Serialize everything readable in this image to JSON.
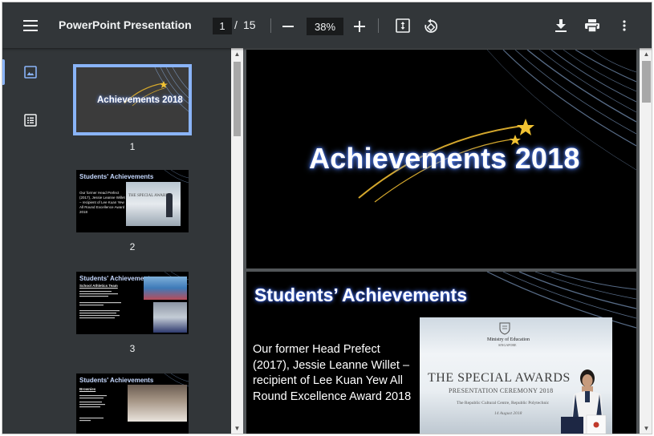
{
  "toolbar": {
    "title": "PowerPoint Presentation",
    "current_page": "1",
    "page_separator": "/",
    "total_pages": "15",
    "zoom": "38%"
  },
  "icons": {
    "menu": "menu-icon",
    "zoom_out": "minus-icon",
    "zoom_in": "plus-icon",
    "fit": "fit-to-page-icon",
    "rotate": "rotate-icon",
    "download": "download-icon",
    "print": "print-icon",
    "more": "more-vert-icon",
    "thumbnails": "image-icon",
    "outline": "outline-icon"
  },
  "colors": {
    "toolbar_bg": "#323639",
    "viewer_bg": "#525659",
    "accent": "#8ab4f8"
  },
  "thumbnails": [
    {
      "num": "1",
      "title": "Achievements 2018"
    },
    {
      "num": "2",
      "title": "Students' Achievements",
      "body": "Our former Head Prefect (2017), Jessie Leanne Willet – recipient of Lee Kuan Yew All Round Excellence Award 2018",
      "photo_text": "THE SPECIAL AWARDS"
    },
    {
      "num": "3",
      "title": "Students' Achievements",
      "body": "School Athletics Team"
    },
    {
      "num": "4",
      "title": "Students' Achievements",
      "body": "Brownies"
    }
  ],
  "slides": [
    {
      "title": "Achievements 2018"
    },
    {
      "title": "Students’ Achievements",
      "body": "Our former Head Prefect (2017), Jessie Leanne Willet – recipient of Lee Kuan Yew All Round Excellence Award 2018",
      "photo": {
        "ministry": "Ministry of Education",
        "country": "SINGAPORE",
        "heading": "THE SPECIAL AWARDS",
        "subheading": "PRESENTATION CEREMONY 2018",
        "venue": "The Republic Cultural Centre, Republic Polytechnic",
        "date": "14 August 2018"
      }
    }
  ]
}
